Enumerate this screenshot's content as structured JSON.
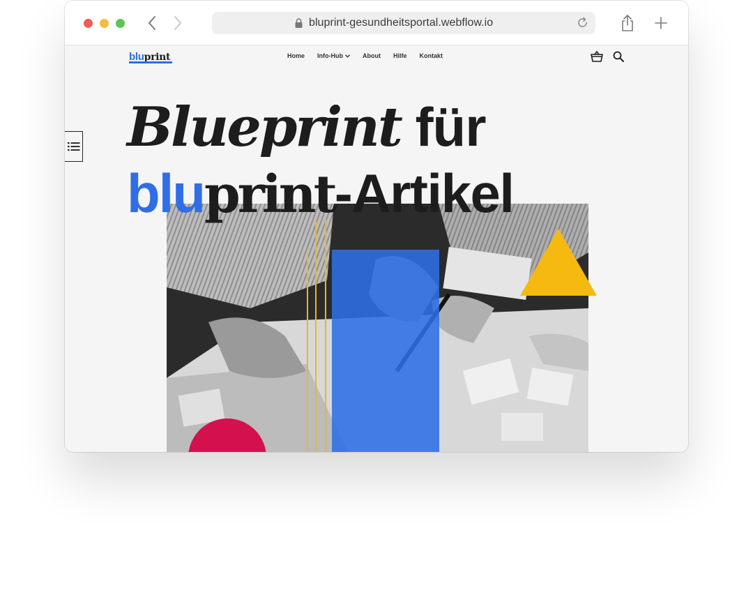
{
  "browser": {
    "url": "bluprint-gesundheitsportal.webflow.io",
    "icons": [
      "back-icon",
      "forward-icon",
      "lock-icon",
      "reload-icon",
      "share-icon",
      "plus-icon"
    ]
  },
  "site": {
    "logo": {
      "blu": "blu",
      "print": "print"
    },
    "nav": [
      {
        "label": "Home"
      },
      {
        "label": "Info-Hub",
        "has_dropdown": true
      },
      {
        "label": "About"
      },
      {
        "label": "Hilfe"
      },
      {
        "label": "Kontakt"
      }
    ],
    "icons": [
      "basket-icon",
      "search-icon",
      "list-icon"
    ]
  },
  "hero": {
    "line1_italic": "Blueprint",
    "line1_rest": " für",
    "line2_blu": "blu",
    "line2_print": "print",
    "line2_rest": "-Artikel"
  },
  "colors": {
    "brand_blue": "#2f6ee6",
    "accent_yellow": "#f5b90f",
    "accent_pink": "#d4104f",
    "text_dark": "#1d1d1d"
  }
}
